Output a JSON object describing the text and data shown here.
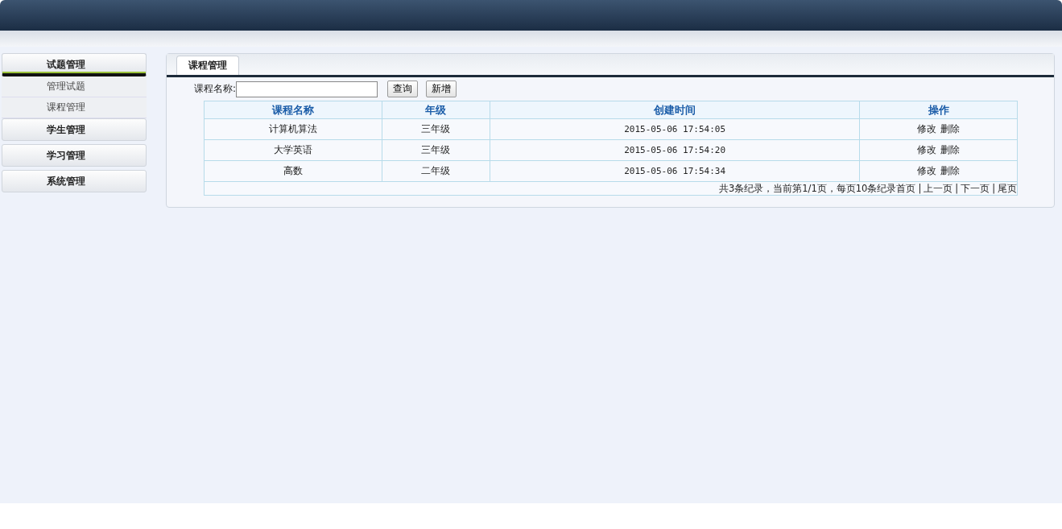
{
  "sidebar": {
    "groups": [
      {
        "label": "试题管理",
        "expanded": true,
        "children": [
          {
            "label": "管理试题"
          },
          {
            "label": "课程管理"
          }
        ]
      },
      {
        "label": "学生管理",
        "expanded": false
      },
      {
        "label": "学习管理",
        "expanded": false
      },
      {
        "label": "系统管理",
        "expanded": false
      }
    ]
  },
  "tabs": [
    {
      "label": "课程管理",
      "selected": true
    }
  ],
  "search": {
    "label": "课程名称:"
  },
  "buttons": [
    "查询",
    "新增"
  ],
  "table": {
    "columns": [
      "课程名称",
      "年级",
      "创建时间",
      "操作"
    ],
    "rows": [
      {
        "name": "计算机算法",
        "grade": "三年级",
        "created": "2015-05-06 17:54:05",
        "actions": [
          "修改",
          "删除"
        ]
      },
      {
        "name": "大学英语",
        "grade": "三年级",
        "created": "2015-05-06 17:54:20",
        "actions": [
          "修改",
          "删除"
        ]
      },
      {
        "name": "高数",
        "grade": "二年级",
        "created": "2015-05-06 17:54:34",
        "actions": [
          "修改",
          "删除"
        ]
      }
    ]
  },
  "pagination": {
    "summary": "共3条纪录，当前第1/1页，每页10条纪录",
    "separator": "|",
    "links": [
      "首页",
      "上一页",
      "下一页",
      "尾页"
    ]
  }
}
